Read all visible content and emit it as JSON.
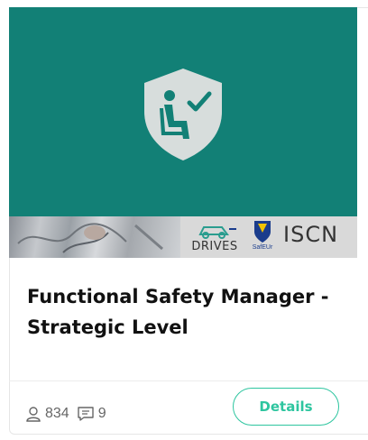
{
  "course": {
    "title": "Functional Safety Manager - Strategic Level",
    "thumbnail_icon": "shield-person-check-icon",
    "accent_color": "#128076"
  },
  "logos": {
    "drives": "DRIVES",
    "safeur": "SafEUr",
    "iscn": "ISCN"
  },
  "stats": {
    "students_icon": "user-icon",
    "students": "834",
    "comments_icon": "comment-icon",
    "comments": "9"
  },
  "actions": {
    "details_label": "Details",
    "button_color": "#2dc59f"
  }
}
